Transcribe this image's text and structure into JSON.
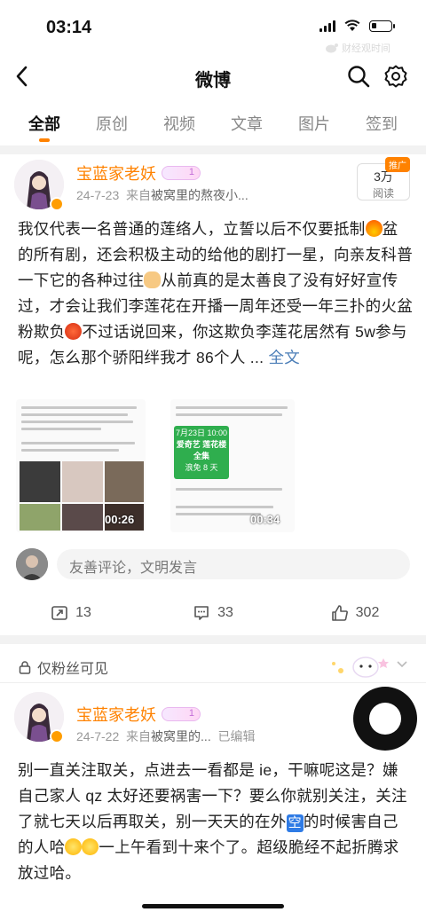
{
  "status": {
    "time": "03:14",
    "watermark": "财经观时间"
  },
  "nav": {
    "title": "微博"
  },
  "tabs": [
    "全部",
    "原创",
    "视频",
    "文章",
    "图片",
    "签到"
  ],
  "post1": {
    "author": "宝蓝家老妖",
    "date": "24-7-23",
    "source_prefix": "来自",
    "source": "被窝里的熬夜小...",
    "read_count": "3万",
    "read_label": "阅读",
    "push_tag": "推广",
    "text_parts": [
      "我仅代表一名普通的莲络人，立誓以后不仅要抵制",
      "盆的所有剧，还会积极主动的给他的剧打一星，向亲友科普一下它的各种过往",
      "从前真的是太善良了没有好好宣传过，才会让我们李莲花在开播一周年还受一年三扑的火盆粉欺负",
      "不过话说回来，你这欺负李莲花居然有 5w参与呢，怎么那个骄阳绊我才 86个人 ... "
    ],
    "more": "全文",
    "video1_time": "00:26",
    "video2_time": "00:34",
    "video2_date": "7月23日 10:00",
    "video2_title1": "爱奇艺 莲花楼",
    "video2_title2": "全集",
    "video2_sub": "浪免 8 天",
    "comment_placeholder": "友善评论，文明发言",
    "reposts": "13",
    "comments": "33",
    "likes": "302"
  },
  "fans_only": "仅粉丝可见",
  "post2": {
    "author": "宝蓝家老妖",
    "date": "24-7-22",
    "source_prefix": "来自",
    "source": "被窝里的...",
    "edited": "已编辑",
    "text_parts": [
      "别一直关注取关，点进去一看都是 ie，干嘛呢这是？嫌自己家人 qz 太好还要祸害一下？要么你就别关注，关注了就七天以后再取关，别一天天的在外",
      "的时候害自己的人哈",
      "一上午看到十来个了。超级脆经不起折腾求放过哈。"
    ],
    "empty_char": "空"
  },
  "colors": {
    "accent": "#ff8200",
    "link": "#4a7db7",
    "author": "#ff8200"
  }
}
